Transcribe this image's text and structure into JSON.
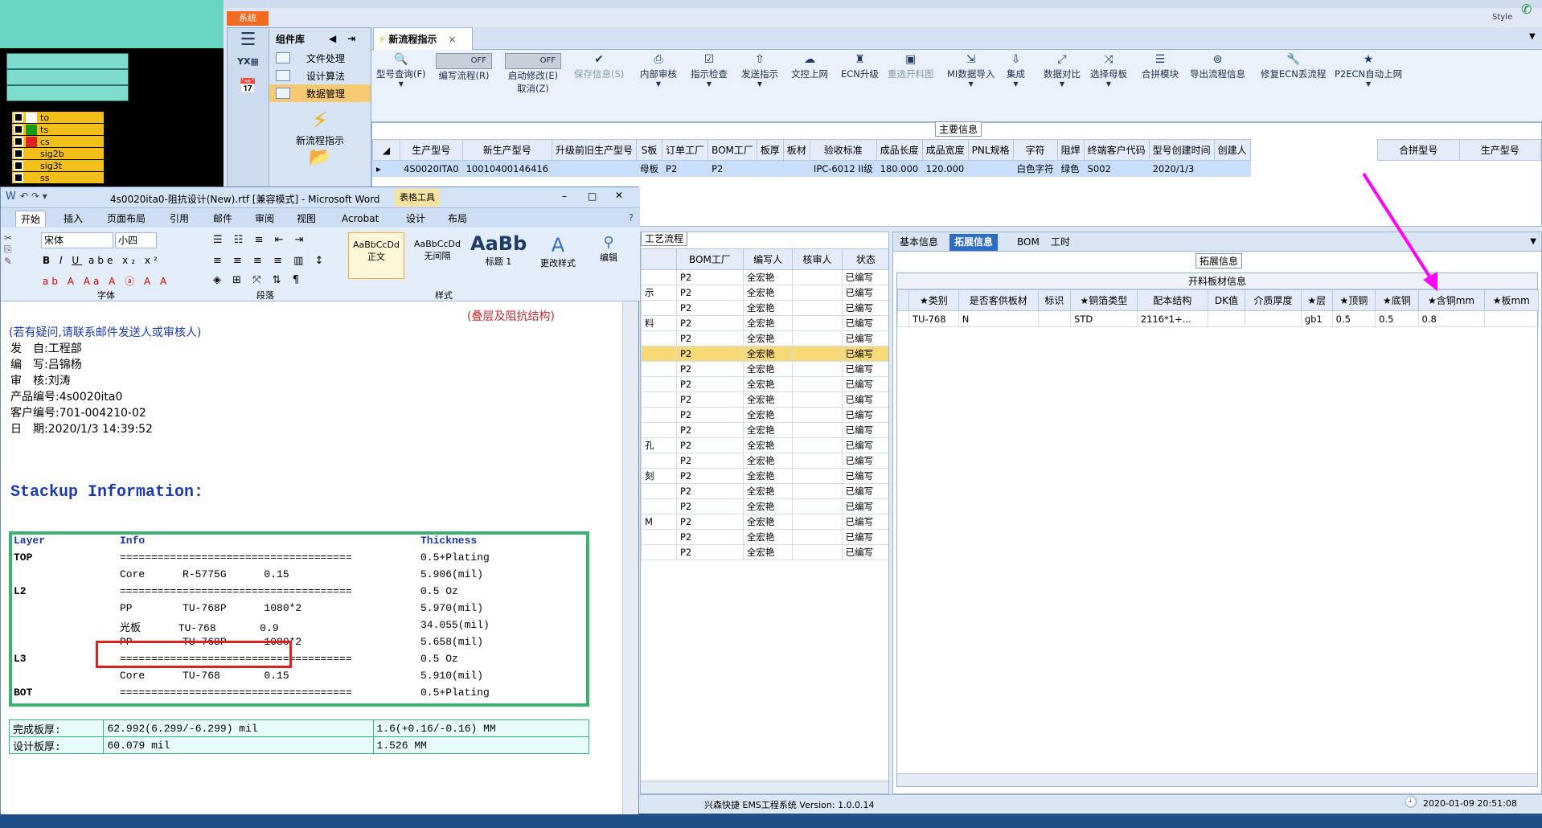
{
  "top": {
    "style_label": "Style"
  },
  "system_tab": "系统",
  "sidebar": {
    "title": "组件库",
    "items": [
      "文件处理",
      "设计算法",
      "数据管理"
    ],
    "new_flow": "新流程指示"
  },
  "cad_layers": [
    {
      "name": "to",
      "color": "#ffffff"
    },
    {
      "name": "ts",
      "color": "#1a9a1a"
    },
    {
      "name": "cs",
      "color": "#e02020"
    },
    {
      "name": "sig2b",
      "color": "#f2c018"
    },
    {
      "name": "sig3t",
      "color": "#f2c018"
    },
    {
      "name": "ss",
      "color": "#f2c018"
    }
  ],
  "main_tab": "新流程指示",
  "toolbar": {
    "model_query": "型号查询(F)",
    "edit_flow": "编写流程(R)",
    "start_modify": "启动修改(E)",
    "cancel_modify": "取消(Z)",
    "toggle_off": "OFF",
    "save_info": "保存信息(S)",
    "internal_review": "内部审核",
    "indicate_check": "指示检查",
    "publish": "发送指示",
    "upload": "文控上网",
    "ecn": "ECN升级",
    "reselect": "重选开料图",
    "mi_import": "MI数据导入",
    "integrate": "集成",
    "compare": "数据对比",
    "select_board": "选择母板",
    "merge_module": "合拼模块",
    "export_flow": "导出流程信息",
    "fix_ecn": "修复ECN丢流程",
    "p2ecn": "P2ECN自动上网"
  },
  "main_info": {
    "group_label": "主要信息",
    "columns": [
      "生产型号",
      "新生产型号",
      "升级前旧生产型号",
      "S板",
      "订单工厂",
      "BOM工厂",
      "板厚",
      "板材",
      "验收标准",
      "成品长度",
      "成品宽度",
      "PNL规格",
      "字符",
      "阻焊",
      "终端客户代码",
      "型号创建时间",
      "创建人"
    ],
    "row": [
      "4S0020ITA0",
      "10010400146416",
      "",
      "母板",
      "P2",
      "P2",
      "",
      "",
      "IPC-6012 II级",
      "180.000",
      "120.000",
      "",
      "白色字符",
      "绿色",
      "S002",
      "2020/1/3",
      ""
    ],
    "merge_columns": [
      "合拼型号",
      "生产型号"
    ]
  },
  "process": {
    "group_label": "工艺流程",
    "columns": [
      "BOM工厂",
      "编写人",
      "核审人",
      "状态"
    ],
    "left_fragments": [
      "示",
      "料",
      "孔",
      "刻",
      "M"
    ],
    "row_factory": "P2",
    "row_writer": "全宏艳",
    "row_status": "已编写",
    "row_count": 19
  },
  "right": {
    "tabs": [
      "基本信息",
      "拓展信息",
      "BOM",
      "工时"
    ],
    "group_label": "拓展信息",
    "section_title": "开料板材信息",
    "columns": [
      "★类别",
      "是否客供板材",
      "标识",
      "★铜箔类型",
      "配本结构",
      "DK值",
      "介质厚度",
      "★层",
      "★顶铜",
      "★底铜",
      "★含铜mm",
      "★板mm"
    ],
    "row": [
      "TU-768",
      "N",
      "",
      "STD",
      "2116*1+...",
      "",
      "",
      "gb1",
      "0.5",
      "0.5",
      "0.8",
      ""
    ]
  },
  "status": {
    "system": "兴森快捷 EMS工程系统 Version: 1.0.0.14",
    "datetime": "2020-01-09 20:51:08"
  },
  "word": {
    "title": "4s0020ita0-阻抗设计(New).rtf [兼容模式] - Microsoft Word",
    "table_tools": "表格工具",
    "tabs": [
      "开始",
      "插入",
      "页面布局",
      "引用",
      "邮件",
      "审阅",
      "视图",
      "Acrobat",
      "设计",
      "布局"
    ],
    "font_name": "宋体",
    "font_size": "小四",
    "styles": [
      "AaBbCcDd",
      "AaBbCcDd",
      "AaBb"
    ],
    "style_names": [
      "正文",
      "无间隔",
      "标题 1"
    ],
    "change_style": "更改样式",
    "edit": "编辑",
    "groups": [
      "字体",
      "段落",
      "样式"
    ],
    "doc": {
      "header_right": "(叠层及阻抗结构)",
      "note": "(若有疑问,请联系邮件发送人或审核人)",
      "lines": [
        "发　自:工程部",
        "编　写:吕锦杨",
        "审　核:刘涛",
        "产品编号:4s0020ita0",
        "客户编号:701-004210-02",
        "日　期:2020/1/3 14:39:52"
      ],
      "stackup_title": "Stackup Information:",
      "stack_header": [
        "Layer",
        "Info",
        "Thickness"
      ],
      "stack_rows": [
        [
          "TOP",
          "=====================================",
          "0.5+Plating"
        ],
        [
          "",
          "Core      R-5775G      0.15",
          "5.906(mil)"
        ],
        [
          "L2",
          "=====================================",
          "0.5 Oz"
        ],
        [
          "",
          "PP        TU-768P      1080*2",
          "5.970(mil)"
        ],
        [
          "",
          "光板      TU-768       0.9",
          "34.055(mil)"
        ],
        [
          "",
          "PP        TU-768P      1080*2",
          "5.658(mil)"
        ],
        [
          "L3",
          "=====================================",
          "0.5 Oz"
        ],
        [
          "",
          "Core      TU-768       0.15",
          "5.910(mil)"
        ],
        [
          "BOT",
          "=====================================",
          "0.5+Plating"
        ]
      ],
      "finish_rows": [
        [
          "完成板厚:",
          "62.992(6.299/-6.299) mil",
          "1.6(+0.16/-0.16) MM"
        ],
        [
          "设计板厚:",
          "60.079 mil",
          "1.526 MM"
        ]
      ]
    }
  }
}
